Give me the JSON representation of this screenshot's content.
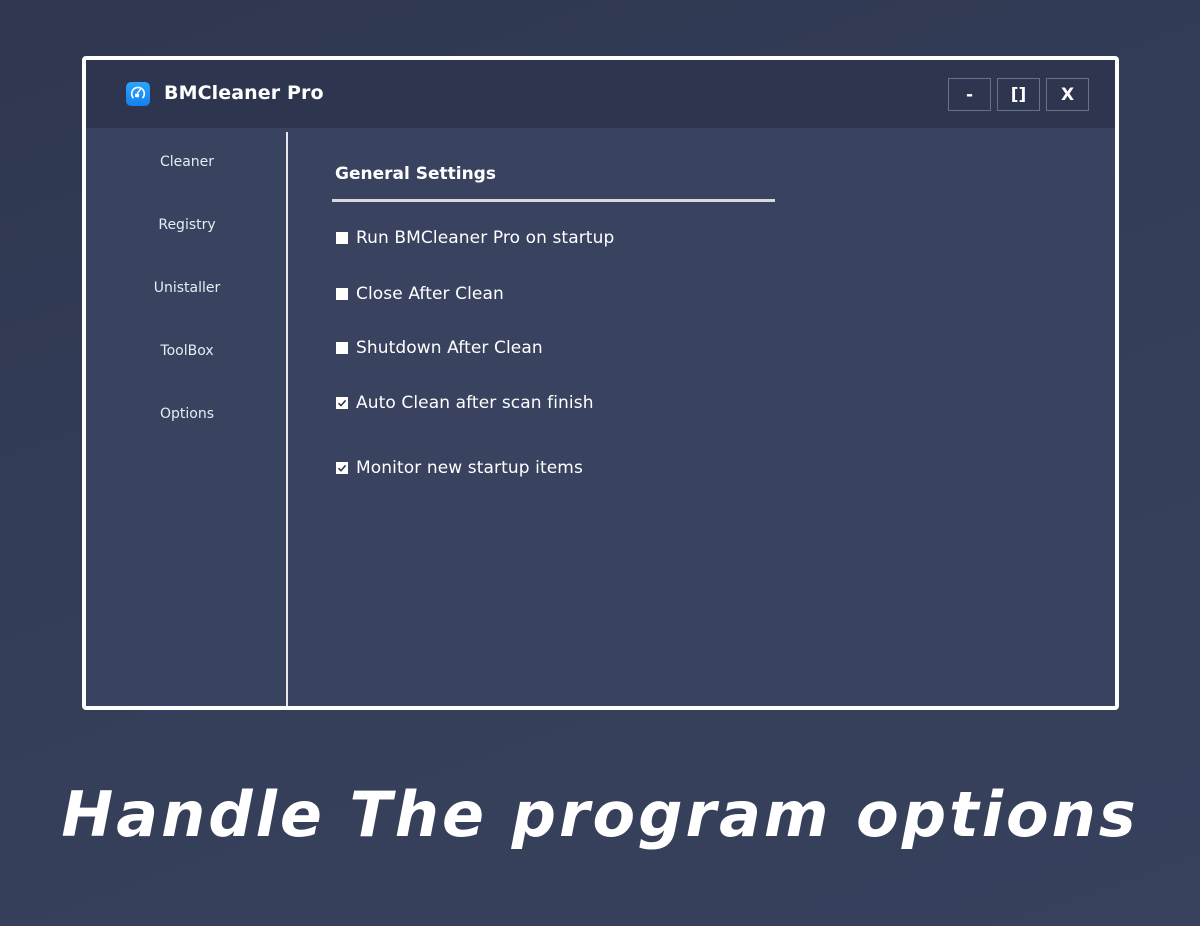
{
  "window": {
    "title": "BMCleaner Pro",
    "icon": "broom-gauge-icon",
    "controls": {
      "minimize_label": "-",
      "maximize_label": "[]",
      "close_label": "X"
    }
  },
  "sidebar": {
    "items": [
      {
        "label": "Cleaner"
      },
      {
        "label": "Registry"
      },
      {
        "label": "Unistaller"
      },
      {
        "label": "ToolBox"
      },
      {
        "label": "Options"
      }
    ]
  },
  "settings": {
    "section_title": "General Settings",
    "options": [
      {
        "label": "Run BMCleaner Pro on startup",
        "checked": false
      },
      {
        "label": "Close After Clean",
        "checked": false
      },
      {
        "label": "Shutdown After Clean",
        "checked": false
      },
      {
        "label": "Auto Clean after scan finish",
        "checked": true
      },
      {
        "label": "Monitor new startup items",
        "checked": true
      }
    ]
  },
  "caption": "Handle The program options",
  "colors": {
    "background": "#323a54",
    "window_bg": "#394360",
    "titlebar_bg": "#2e354e",
    "accent_icon": "#1e90ff",
    "text": "#ffffff"
  }
}
